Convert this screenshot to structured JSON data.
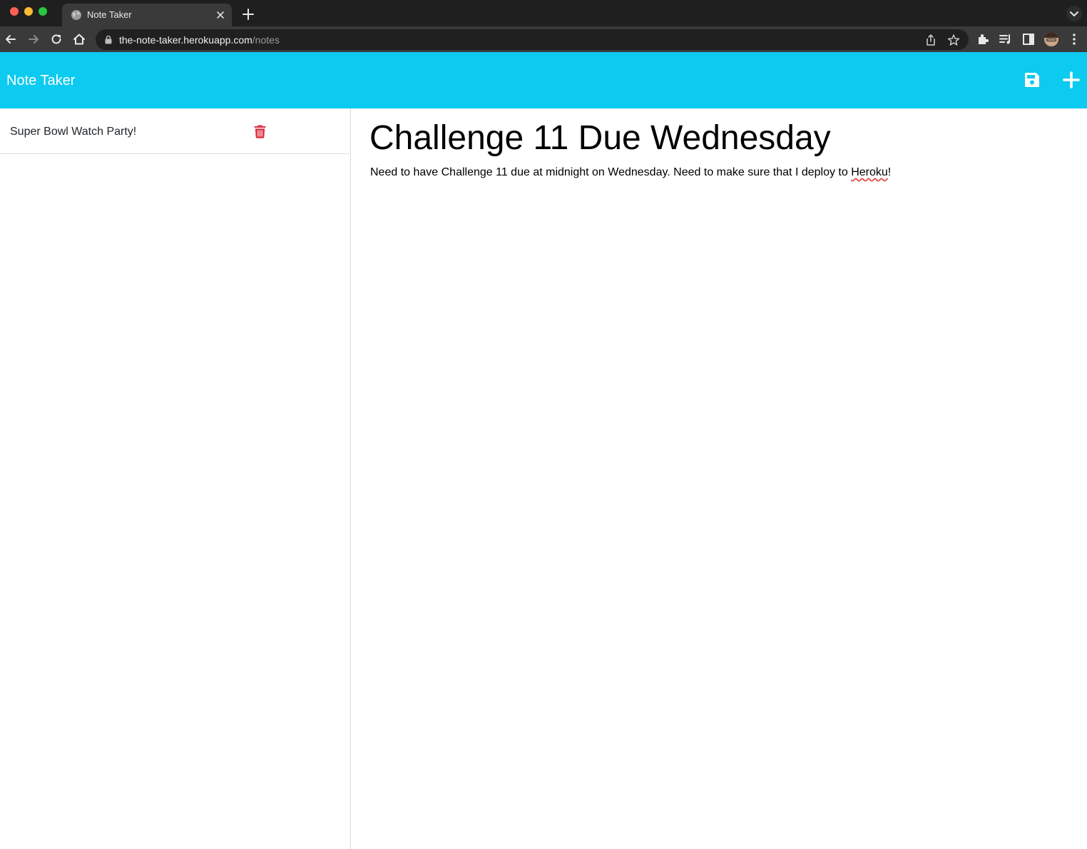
{
  "browser": {
    "tab": {
      "title": "Note Taker"
    },
    "url": {
      "host": "the-note-taker.herokuapp.com",
      "path": "/notes"
    },
    "icons": [
      "back-icon",
      "forward-icon",
      "reload-icon",
      "home-icon",
      "lock-icon",
      "share-icon",
      "star-icon",
      "extensions-icon",
      "reading-list-icon",
      "side-panel-icon",
      "avatar",
      "more-icon"
    ]
  },
  "app": {
    "brand": "Note Taker",
    "accent": "#0dcaf0",
    "delete_color": "#dc3545",
    "notes": [
      {
        "title": "Super Bowl Watch Party!"
      }
    ],
    "active_note": {
      "title": "Challenge 11 Due Wednesday",
      "text_before": "Need to have Challenge 11 due at midnight on Wednesday. Need to make sure that I deploy to ",
      "text_misspelled": "Heroku",
      "text_after": "!"
    }
  }
}
